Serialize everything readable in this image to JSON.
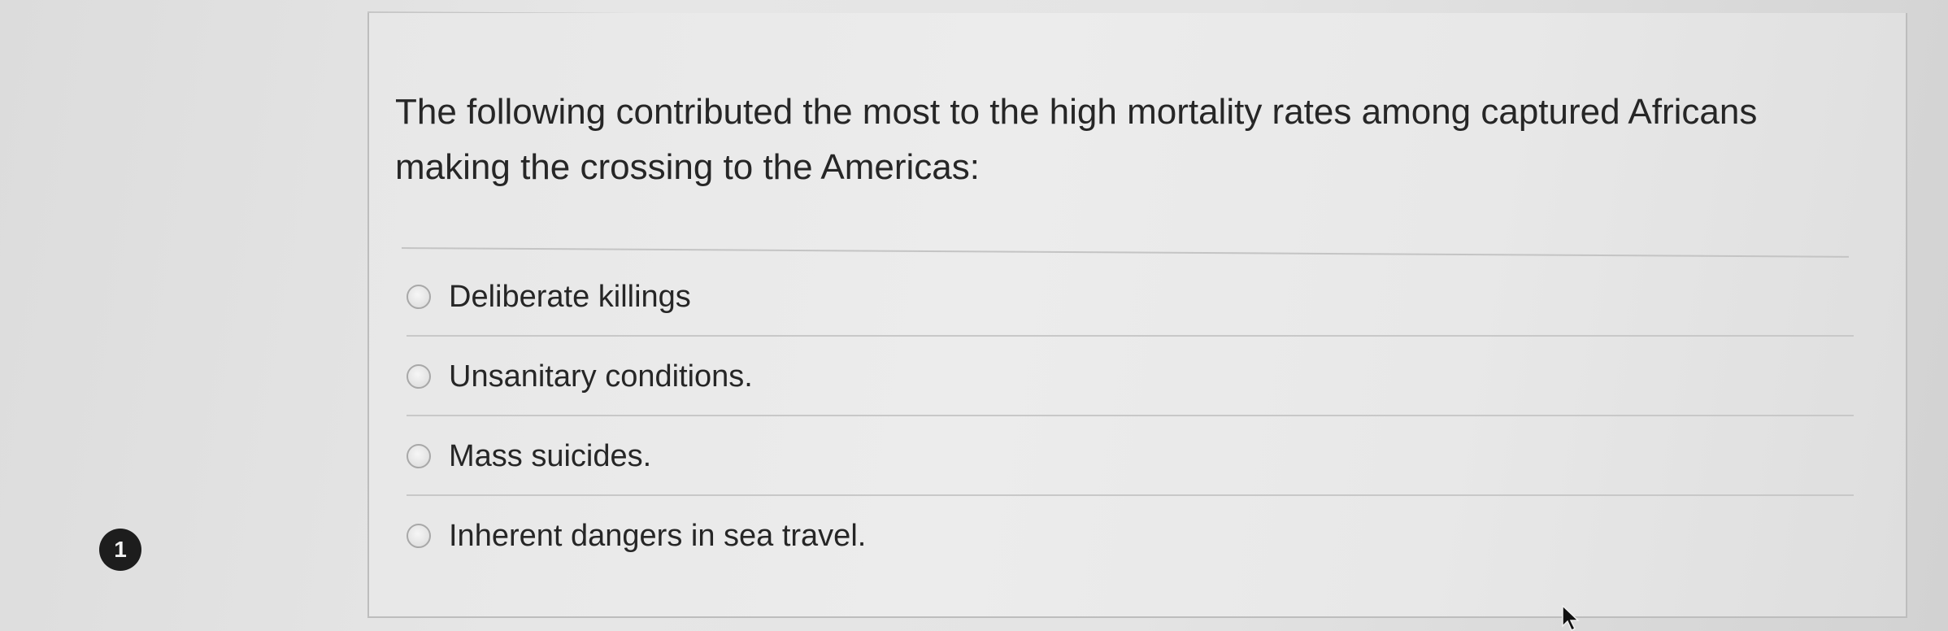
{
  "question": {
    "number": "1",
    "prompt": "The following contributed the most to the high mortality rates among captured Africans making the crossing to the Americas:",
    "options": [
      {
        "label": "Deliberate killings",
        "selected": false
      },
      {
        "label": "Unsanitary conditions.",
        "selected": false
      },
      {
        "label": "Mass suicides.",
        "selected": false
      },
      {
        "label": "Inherent dangers in sea travel.",
        "selected": false
      }
    ]
  },
  "icons": {
    "cursor": "arrow-cursor-icon",
    "radio": "radio-button-icon"
  },
  "colors": {
    "badge_background": "#1d1d1d",
    "badge_text": "#f2f2f2",
    "text": "#262626",
    "divider": "#c4c4c4"
  }
}
